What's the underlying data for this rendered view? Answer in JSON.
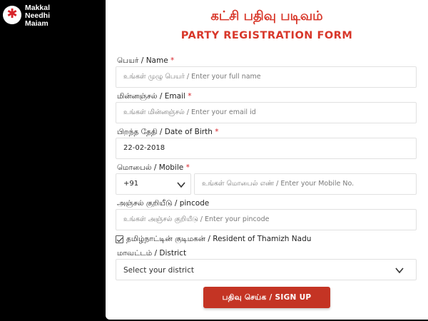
{
  "brand": {
    "line1": "Makkal",
    "line2": "Needhi",
    "line3": "Maiam",
    "accent": "#d8232a"
  },
  "form": {
    "title_ta": "கட்சி பதிவு படிவம்",
    "title_en": "PARTY REGISTRATION FORM",
    "name": {
      "label": "பெயர் / Name",
      "required": "*",
      "placeholder": "உங்கள் முழு பெயர் / Enter your full name"
    },
    "email": {
      "label": "மின்னஞ்சல் / Email",
      "required": "*",
      "placeholder": "உங்கள் மின்னஞ்சல் / Enter your email id"
    },
    "dob": {
      "label": "பிறந்த தேதி / Date of Birth",
      "required": "*",
      "value": "22-02-2018"
    },
    "mobile": {
      "label": "மொபைல் / Mobile",
      "required": "*",
      "country_code": "+91",
      "placeholder": "உங்கள் மொபைல் எண் / Enter your Mobile No."
    },
    "pincode": {
      "label": "அஞ்சல் குறியீடு / pincode",
      "placeholder": "உங்கள் அஞ்சல் குறியீடு / Enter your pincode"
    },
    "resident": {
      "label": "தமிழ்நாட்டின் குடிமகன் / Resident of Thamizh Nadu",
      "checked": true
    },
    "district": {
      "label": "மாவட்டம் / District",
      "selected": "Select your district"
    },
    "submit_label": "பதிவு செய்க / SIGN UP",
    "button_color": "#c43424"
  }
}
